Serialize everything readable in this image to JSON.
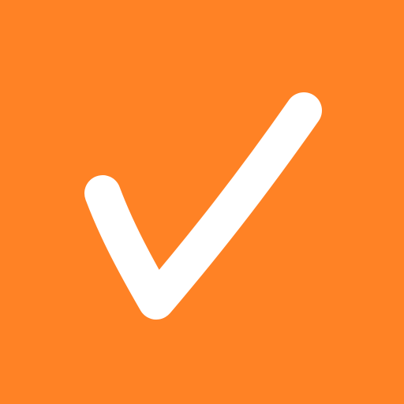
{
  "icon": {
    "name": "checkmark-icon",
    "background_color": "#FF8225",
    "mark_color": "#FFFFFF"
  }
}
